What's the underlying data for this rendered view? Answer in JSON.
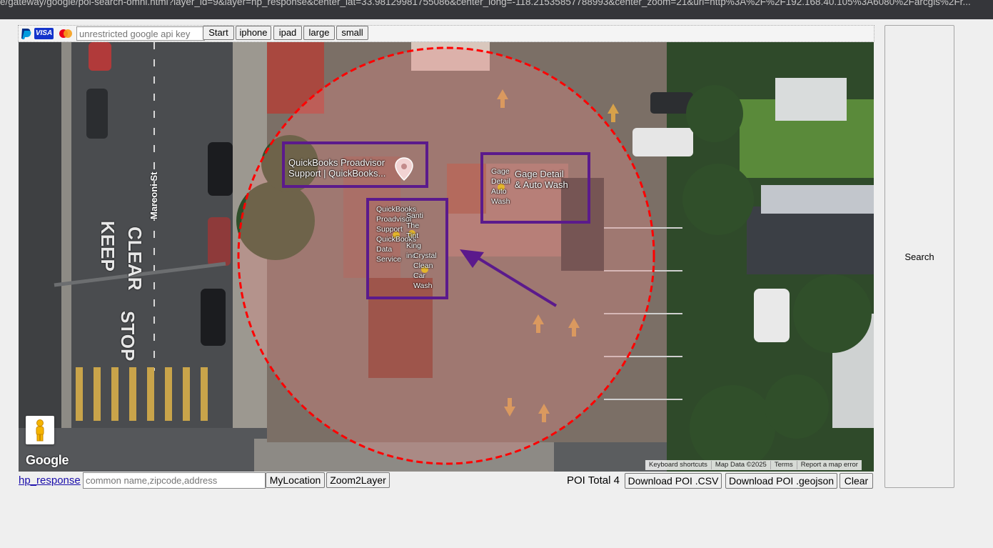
{
  "browser": {
    "url": "e/gateway/google/poi-search-omni.html?layer_id=9&layer=hp_response&center_lat=33.98129981755086&center_long=-118.21535857788993&center_zoom=21&url=http%3A%2F%2F192.168.40.105%3A6080%2Farcgis%2Fr..."
  },
  "toolbar": {
    "api_key_placeholder": "unrestricted google api key",
    "start_label": "Start",
    "iphone_label": "iphone",
    "ipad_label": "ipad",
    "large_label": "large",
    "small_label": "small",
    "payment_icons": [
      "paypal-icon",
      "visa-icon",
      "mastercard-icon"
    ],
    "visa_text": "VISA"
  },
  "map": {
    "street_label": "Marconi St",
    "road_markings": [
      "KEEP",
      "CLEAR",
      "STOP"
    ],
    "pois": [
      {
        "name": "QuickBooks Proadvisor Support | QuickBooks...",
        "lines": [
          "QuickBooks Proadvisor",
          "Support | QuickBooks..."
        ]
      },
      {
        "name": "Gage Detail & Auto Wash",
        "lines": [
          "Gage Detail",
          "& Auto Wash"
        ]
      }
    ],
    "cluster_labels": {
      "quickbooks": [
        "QuickBooks",
        "Proadvisor",
        "Support",
        "QuickBooks",
        "Data",
        "Service"
      ],
      "santi": [
        "Santi",
        "The",
        "Tint",
        "King",
        "inc"
      ],
      "crystal": [
        "Crystal",
        "Clean",
        "Car",
        "Wash"
      ],
      "gage": [
        "Gage",
        "Detail",
        "Auto",
        "Wash"
      ]
    },
    "google_logo": "Google",
    "attribution": {
      "keyboard": "Keyboard shortcuts",
      "data": "Map Data ©2025",
      "terms": "Terms",
      "report": "Report a map error"
    },
    "colors": {
      "radius_circle": "#ff0000",
      "annotation": "#5b1a8c"
    }
  },
  "search_panel": {
    "search_label": "Search"
  },
  "bottombar": {
    "layer_link": "hp_response",
    "poi_placeholder": "common name,zipcode,address",
    "mylocation_label": "MyLocation",
    "zoom2layer_label": "Zoom2Layer",
    "poi_total": "POI Total 4",
    "download_csv_label": "Download POI .CSV",
    "download_geojson_label": "Download POI .geojson",
    "clear_label": "Clear"
  }
}
